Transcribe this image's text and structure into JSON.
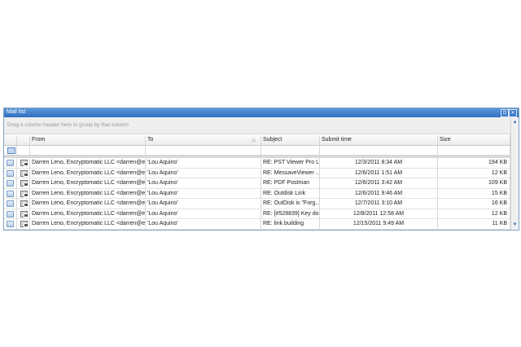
{
  "window": {
    "title": "Mail list",
    "pin_icon": "pin-icon",
    "close_icon": "close-icon"
  },
  "group_bar": {
    "hint": "Drag a column header here to group by that column"
  },
  "columns": {
    "from": "From",
    "to": "To",
    "subject": "Subject",
    "submit_time": "Submit time",
    "size": "Size",
    "sort_column": "To",
    "sort_direction": "ascending"
  },
  "rows": [
    {
      "from": "Darren Leno, Encryptomatic LLC <darren@enc...",
      "to": "'Lou Aquino'",
      "subject": "RE: PST Viewer Pro L...",
      "submit_time": "12/3/2011 8:34 AM",
      "size": "194 KB"
    },
    {
      "from": "Darren Leno, Encryptomatic LLC <darren@enc...",
      "to": "'Lou Aquino'",
      "subject": "RE: MessaveViewer ...",
      "submit_time": "12/6/2011 1:51 AM",
      "size": "12 KB"
    },
    {
      "from": "Darren Leno, Encryptomatic LLC <darren@enc...",
      "to": "'Lou Aquino'",
      "subject": "RE: PDF Postman",
      "submit_time": "12/6/2011 3:42 AM",
      "size": "109 KB"
    },
    {
      "from": "Darren Leno, Encryptomatic LLC <darren@enc...",
      "to": "'Lou Aquino'",
      "subject": "RE: Outdisk Link",
      "submit_time": "12/6/2011 9:46 AM",
      "size": "15 KB"
    },
    {
      "from": "Darren Leno, Encryptomatic LLC <darren@enc...",
      "to": "'Lou Aquino'",
      "subject": "RE: OutDisk is \"Forg...",
      "submit_time": "12/7/2011 3:10 AM",
      "size": "16 KB"
    },
    {
      "from": "Darren Leno, Encryptomatic LLC <darren@enc...",
      "to": "'Lou Aquino'",
      "subject": "RE: [#528839] Key do...",
      "submit_time": "12/8/2011 12:58 AM",
      "size": "12 KB"
    },
    {
      "from": "Darren Leno, Encryptomatic LLC <darren@enc...",
      "to": "'Lou Aquino'",
      "subject": "RE: link building",
      "submit_time": "12/15/2011 9:49 AM",
      "size": "11 KB"
    }
  ],
  "colors": {
    "titlebar": "#2f6fc0",
    "border": "#7fa3c8"
  }
}
